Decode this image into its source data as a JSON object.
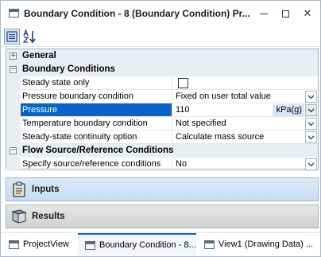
{
  "window": {
    "title": "Boundary Condition - 8 (Boundary Condition) Pr...",
    "controls": {
      "minimize_icon": "minimize-icon",
      "maximize_icon": "maximize-icon",
      "close_icon": "close-icon",
      "close_glyph": "✕"
    }
  },
  "toolbar": {
    "categorized_icon": "categorized-view-icon",
    "alphabetical_icon": "sort-alphabetical-icon"
  },
  "property_grid": {
    "categories": {
      "general": "General",
      "boundary_conditions": "Boundary Conditions",
      "flow_source": "Flow Source/Reference Conditions"
    },
    "rows": {
      "steady_state_only": {
        "name": "Steady state only",
        "checked": false
      },
      "pressure_boundary_condition": {
        "name": "Pressure boundary condition",
        "value": "Fixed on user total value"
      },
      "pressure": {
        "name": "Pressure",
        "value": "110",
        "unit": "kPa(g)"
      },
      "temperature_boundary_condition": {
        "name": "Temperature boundary condition",
        "value": "Not specified"
      },
      "steady_state_continuity": {
        "name": "Steady-state continuity option",
        "value": "Calculate mass source"
      },
      "specify_source": {
        "name": "Specify source/reference conditions",
        "value": "No"
      }
    },
    "expander_glyphs": {
      "collapsed": "+",
      "expanded": "−"
    }
  },
  "panels": {
    "inputs": {
      "label": "Inputs",
      "icon": "clipboard-icon"
    },
    "results": {
      "label": "Results",
      "icon": "results-book-icon"
    }
  },
  "tabs": [
    {
      "label": "ProjectView",
      "active": false
    },
    {
      "label": "Boundary Condition - 8...",
      "active": true
    },
    {
      "label": "View1 (Drawing Data) ...",
      "active": false
    }
  ],
  "colors": {
    "selection": "#0a64c8",
    "category_bg": "#e9eef4",
    "unit_bg": "#d5e6f6"
  }
}
